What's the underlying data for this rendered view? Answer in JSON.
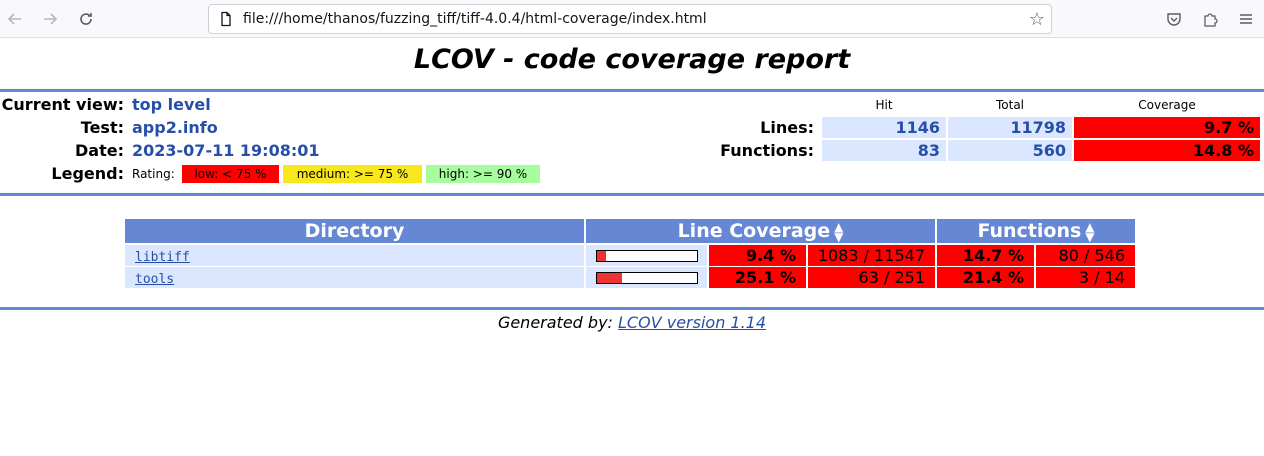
{
  "browser": {
    "url": "file:///home/thanos/fuzzing_tiff/tiff-4.0.4/html-coverage/index.html"
  },
  "report": {
    "title": "LCOV - code coverage report",
    "header": {
      "current_view_label": "Current view:",
      "current_view": "top level",
      "test_label": "Test:",
      "test": "app2.info",
      "date_label": "Date:",
      "date": "2023-07-11 19:08:01",
      "legend_label": "Legend:",
      "rating_label": "Rating:",
      "legend": {
        "low": "low: < 75 %",
        "medium": "medium: >= 75 %",
        "high": "high: >= 90 %"
      },
      "colors": {
        "low": "#ff0000",
        "medium": "#f8e71c",
        "high": "#a7fc9d",
        "blue_cell": "#dae7fe",
        "header": "#6688d4"
      }
    },
    "summary": {
      "columns": [
        "Hit",
        "Total",
        "Coverage"
      ],
      "lines": {
        "label": "Lines:",
        "hit": "1146",
        "total": "11798",
        "coverage": "9.7 %"
      },
      "functions": {
        "label": "Functions:",
        "hit": "83",
        "total": "560",
        "coverage": "14.8 %"
      }
    },
    "table": {
      "headers": {
        "directory": "Directory",
        "line_coverage": "Line Coverage",
        "functions": "Functions"
      },
      "rows": [
        {
          "name": "libtiff",
          "line_pct_value": 0.094,
          "line_pct": "9.4 %",
          "line_count": "1083 / 11547",
          "func_pct": "14.7 %",
          "func_count": "80 / 546"
        },
        {
          "name": "tools",
          "line_pct_value": 0.251,
          "line_pct": "25.1 %",
          "line_count": "63 / 251",
          "func_pct": "21.4 %",
          "func_count": "3 / 14"
        }
      ]
    },
    "footer": {
      "generated_by": "Generated by:",
      "link_text": "LCOV version 1.14"
    }
  }
}
